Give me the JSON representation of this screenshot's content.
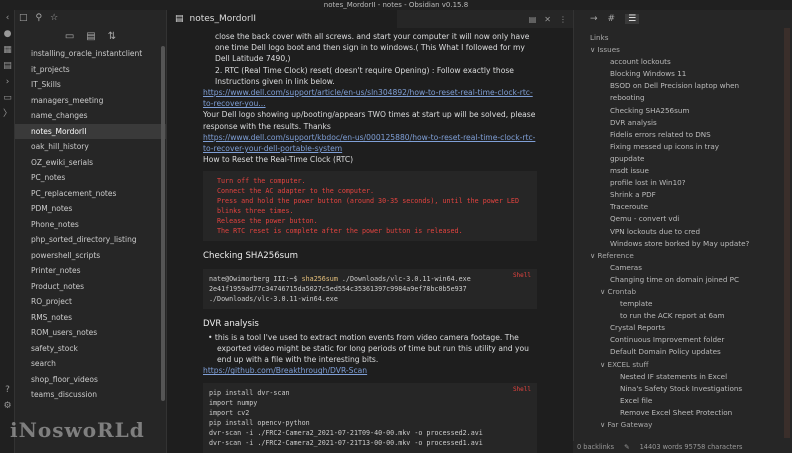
{
  "window_title": "notes_MordorII - notes - Obsidian v0.15.8",
  "ribbon_icons": [
    "collapse-left-icon",
    "graph-icon",
    "calendar-icon",
    "template-icon",
    "command-icon",
    "file-copy-icon",
    "terminal-icon",
    "settings-help-icon",
    "settings-icon"
  ],
  "left_panel": {
    "files": [
      "installing_oracle_instantclient",
      "it_projects",
      "IT_Skills",
      "managers_meeting",
      "name_changes",
      "notes_MordorII",
      "oak_hill_history",
      "OZ_ewiki_serials",
      "PC_notes",
      "PC_replacement_notes",
      "PDM_notes",
      "Phone_notes",
      "php_sorted_directory_listing",
      "powershell_scripts",
      "Printer_notes",
      "Product_notes",
      "RO_project",
      "RMS_notes",
      "ROM_users_notes",
      "safety_stock",
      "search",
      "shop_floor_videos",
      "teams_discussion"
    ],
    "active_index": 5
  },
  "center": {
    "tab_title": "notes_MordorII",
    "lines": [
      {
        "type": "li",
        "text": "close the back cover with all screws. and start your computer it will now only have one time Dell logo boot and then sign in to windows.( This What I followed for my Dell Latitude 7490,)"
      },
      {
        "type": "li2",
        "text": "2. RTC (Real Time Clock) reset( doesn't require Opening) : Follow exactly those Instructions given in link below."
      },
      {
        "type": "link",
        "text": "https://www.dell.com/support/article/en-us/sln304892/how-to-reset-real-time-clock-rtc-to-recover-you..."
      },
      {
        "type": "p",
        "text": "Your Dell logo showing up/booting/appears TWO times at start up will be solved, please response with the results. Thanks"
      },
      {
        "type": "link",
        "text": "https://www.dell.com/support/kbdoc/en-us/000125880/how-to-reset-real-time-clock-rtc-to-recover-your-dell-portable-system"
      },
      {
        "type": "p",
        "text": "How to Reset the Real-Time Clock (RTC)"
      }
    ],
    "rtc_steps": [
      "Turn off the computer.",
      "Connect the AC adapter to the computer.",
      "Press and hold the power button (around 30-35 seconds), until the power LED blinks three times.",
      "Release the power button.",
      "The RTC reset is complete after the power button is released."
    ],
    "sha_heading": "Checking SHA256sum",
    "sha_lang": "Shell",
    "sha_prompt": "nate@Owimorberg III:~$",
    "sha_cmd": "sha256sum",
    "sha_args": "./Downloads/vlc-3.0.11-win64.exe",
    "sha_output": "2e41f1959ad77c34746715da5027c5ed554c35361397c9984a9ef78bc0b5e937  ./Downloads/vlc-3.0.11-win64.exe",
    "dvr_heading": "DVR analysis",
    "dvr_bullet": "this is a tool I've used to extract motion events from video camera footage. The exported video might be static for long periods of time but run this utility and you end up with a file with the interesting bits.",
    "dvr_link": "https://github.com/Breakthrough/DVR-Scan",
    "dvr_lang": "Shell",
    "dvr_code": [
      "pip install dvr-scan",
      "import numpy",
      "import cv2",
      "pip install opencv-python",
      "dvr-scan -i ./FRC2-Camera2_2021-07-21T09-40-00.mkv -o processed2.avi",
      "dvr-scan -i ./FRC2-Camera2_2021-07-21T13-00-00.mkv -o processed1.avi"
    ]
  },
  "right_panel": {
    "links_label": "Links",
    "items": [
      {
        "t": "∨ Issues",
        "d": 0,
        "h": true
      },
      {
        "t": "account lockouts",
        "d": 1
      },
      {
        "t": "Blocking Windows 11",
        "d": 1
      },
      {
        "t": "BSOD on Dell Precision laptop when",
        "d": 1
      },
      {
        "t": "rebooting",
        "d": 1
      },
      {
        "t": "Checking SHA256sum",
        "d": 1
      },
      {
        "t": "DVR analysis",
        "d": 1
      },
      {
        "t": "Fidelis errors related to DNS",
        "d": 1
      },
      {
        "t": "Fixing messed up icons in tray",
        "d": 1
      },
      {
        "t": "gpupdate",
        "d": 1
      },
      {
        "t": "msdt issue",
        "d": 1
      },
      {
        "t": "profile lost in Win10?",
        "d": 1
      },
      {
        "t": "Shrink a PDF",
        "d": 1
      },
      {
        "t": "Traceroute",
        "d": 1
      },
      {
        "t": "Qemu - convert vdi",
        "d": 1
      },
      {
        "t": "VPN lockouts due to cred",
        "d": 1
      },
      {
        "t": "Windows store borked by May update?",
        "d": 1
      },
      {
        "t": "∨ Reference",
        "d": 0,
        "h": true
      },
      {
        "t": "Cameras",
        "d": 1
      },
      {
        "t": "Changing time on domain joined PC",
        "d": 1
      },
      {
        "t": "∨ Crontab",
        "d": 1,
        "h": true
      },
      {
        "t": "template",
        "d": 2
      },
      {
        "t": "to run the ACK report at 6am",
        "d": 2
      },
      {
        "t": "Crystal Reports",
        "d": 1
      },
      {
        "t": "Continuous Improvement folder",
        "d": 1
      },
      {
        "t": "Default Domain Policy updates",
        "d": 1
      },
      {
        "t": "∨ EXCEL stuff",
        "d": 1,
        "h": true
      },
      {
        "t": "Nested IF statements in Excel",
        "d": 2
      },
      {
        "t": "Nina's Safety Stock Investigations",
        "d": 2
      },
      {
        "t": "Excel file",
        "d": 2
      },
      {
        "t": "Remove Excel Sheet Protection",
        "d": 2
      },
      {
        "t": "∨ Far Gateway",
        "d": 1,
        "h": true
      }
    ],
    "status_backlinks": "0 backlinks",
    "status_words": "14403 words 95758 characters"
  },
  "watermark": "iNoswoRLd"
}
